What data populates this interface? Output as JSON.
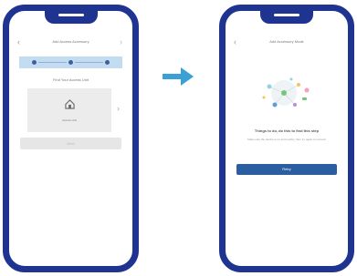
{
  "left_phone": {
    "header": {
      "title": "Add Access Accessory",
      "back_icon": "chevron-left-icon",
      "forward_icon": "chevron-right-icon"
    },
    "steps": {
      "count": 3
    },
    "section_label": "Find Your Access Unit",
    "device_card": {
      "icon": "house-icon",
      "label": "Access Unit"
    },
    "side_icon": "chevron-right-icon",
    "next_button": "Next"
  },
  "transition_arrow": {
    "icon": "arrow-right-icon",
    "color": "#3aa0d6"
  },
  "right_phone": {
    "header": {
      "title": "Add Accessory Mode",
      "back_icon": "chevron-left-icon"
    },
    "illustration": {
      "icon": "scattered-dots-illustration"
    },
    "message_title": "Things to do, do this to find this step",
    "message_body": "Make sure the device is on and nearby, then try again to connect",
    "retry_button": "Retry"
  },
  "colors": {
    "phone_frame": "#1f3391",
    "primary_button": "#2a5ea0",
    "stepper_bg": "#c4dcf2"
  }
}
